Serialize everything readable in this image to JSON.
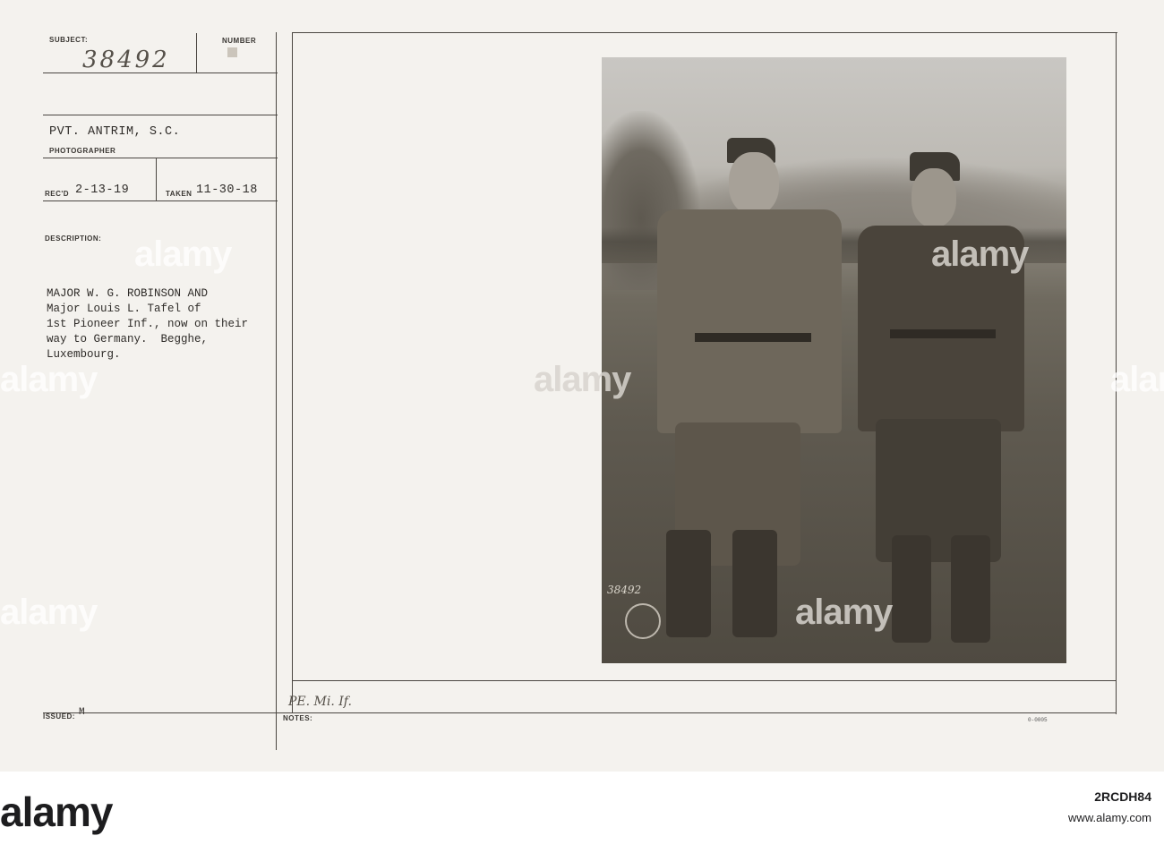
{
  "card": {
    "subject_label": "SUBJECT:",
    "subject_value": "38492",
    "number_label": "NUMBER",
    "photographer_value": "PVT. ANTRIM, S.C.",
    "photographer_label": "PHOTOGRAPHER",
    "recd_label": "REC'D",
    "recd_value": "2-13-19",
    "taken_label": "TAKEN",
    "taken_value": "11-30-18",
    "description_label": "DESCRIPTION:",
    "description_lines": [
      "MAJOR W. G. ROBINSON AND",
      "Major Louis L. Tafel of",
      "1st Pioneer Inf., now on their",
      "way to Germany.  Begghe,",
      "Luxembourg."
    ],
    "issued_label": "ISSUED:",
    "issued_value": "M",
    "notes_label": "NOTES:",
    "notes_handwritten": "PE. Mi. If.",
    "small_code": "0-0005"
  },
  "photo": {
    "negative_number": "38492"
  },
  "watermark": {
    "text": "alamy"
  },
  "footer": {
    "logo_text": "alamy",
    "image_id": "2RCDH84",
    "url": "www.alamy.com"
  }
}
